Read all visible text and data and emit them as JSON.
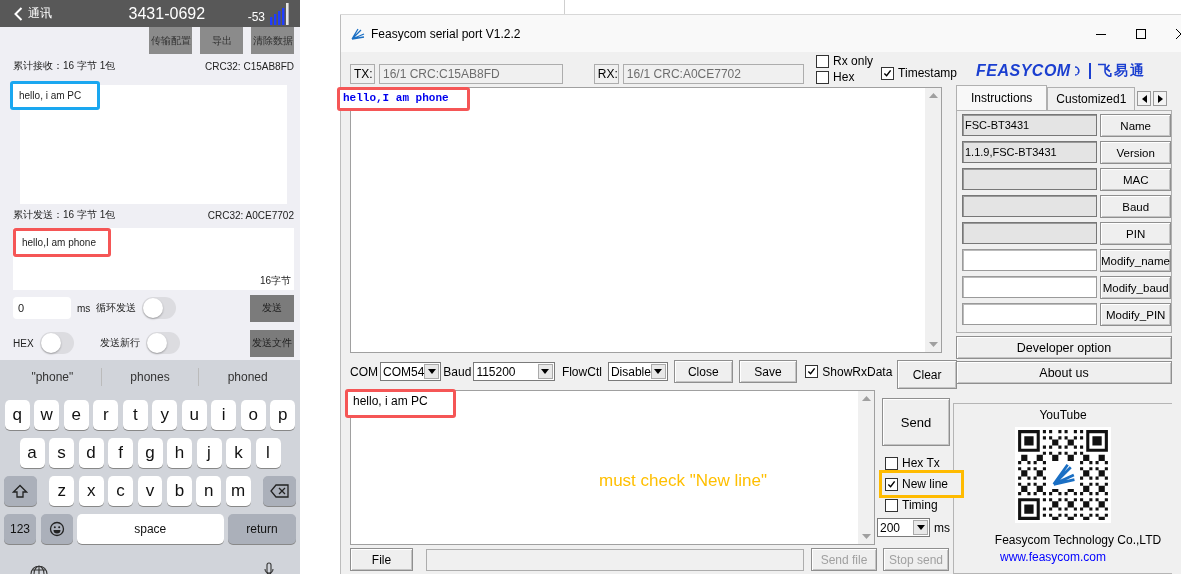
{
  "phone": {
    "back_label": "通讯",
    "title": "3431-0692",
    "rssi": "-53",
    "actions": [
      "传输配置",
      "导出",
      "清除数据"
    ],
    "received": {
      "stats": "累计接收：16 字节  1包",
      "crc": "CRC32:  C15AB8FD",
      "text": "hello, i am PC",
      "color": "#1aa7f0"
    },
    "sent": {
      "stats": "累计发送：16 字节  1包",
      "crc": "CRC32:  A0CE7702",
      "text": "hello,I am phone",
      "color": "#f55656",
      "count": "16字节"
    },
    "interval": {
      "value": "0",
      "unit": "ms"
    },
    "loop_send": {
      "label": "循环发送",
      "on": false
    },
    "hex": {
      "label": "HEX",
      "on": false
    },
    "send_newline": {
      "label": "发送新行",
      "on": false
    },
    "send_button": "发送",
    "send_file_button": "发送文件",
    "keyboard": {
      "suggestions": [
        "\"phone\"",
        "phones",
        "phoned"
      ],
      "top_row": [
        {
          "kind": "letter",
          "label": "q"
        },
        {
          "kind": "letter",
          "label": "w"
        },
        {
          "kind": "letter",
          "label": "e"
        },
        {
          "kind": "letter",
          "label": "r"
        },
        {
          "kind": "letter",
          "label": "t"
        },
        {
          "kind": "letter",
          "label": "y"
        },
        {
          "kind": "letter",
          "label": "u"
        },
        {
          "kind": "letter",
          "label": "i"
        },
        {
          "kind": "letter",
          "label": "o"
        },
        {
          "kind": "letter",
          "label": "p"
        }
      ],
      "middle_row": [
        {
          "kind": "letter",
          "label": "a"
        },
        {
          "kind": "letter",
          "label": "s"
        },
        {
          "kind": "letter",
          "label": "d"
        },
        {
          "kind": "letter",
          "label": "f"
        },
        {
          "kind": "letter",
          "label": "g"
        },
        {
          "kind": "letter",
          "label": "h"
        },
        {
          "kind": "letter",
          "label": "j"
        },
        {
          "kind": "letter",
          "label": "k"
        },
        {
          "kind": "letter",
          "label": "l"
        }
      ],
      "bottom_row": [
        {
          "kind": "shift"
        },
        {
          "kind": "letter",
          "label": "z"
        },
        {
          "kind": "letter",
          "label": "x"
        },
        {
          "kind": "letter",
          "label": "c"
        },
        {
          "kind": "letter",
          "label": "v"
        },
        {
          "kind": "letter",
          "label": "b"
        },
        {
          "kind": "letter",
          "label": "n"
        },
        {
          "kind": "letter",
          "label": "m"
        },
        {
          "kind": "delete"
        }
      ],
      "function_row": [
        {
          "kind": "mode",
          "label": "123"
        },
        {
          "kind": "emoji"
        },
        {
          "kind": "space",
          "label": "space"
        },
        {
          "kind": "return",
          "label": "return"
        }
      ]
    }
  },
  "desktop": {
    "window": {
      "title": "Feasycom serial port V1.2.2"
    },
    "tx_label": "TX:",
    "tx_status": "16/1 CRC:C15AB8FD",
    "rx_label": "RX:",
    "rx_status": "16/1 CRC:A0CE7702",
    "options": [
      {
        "label": "Rx only",
        "checked": false
      },
      {
        "label": "Hex",
        "checked": false
      },
      {
        "label": "Timestamp",
        "checked": true
      }
    ],
    "receive_text": {
      "text": "hello,I am phone",
      "color": "#f55656"
    },
    "controls": {
      "com_label": "COM",
      "com": "COM54",
      "baud_label": "Baud",
      "baud": "115200",
      "flow_label": "FlowCtl",
      "flow": "Disable",
      "buttons": [
        "Close",
        "Save"
      ],
      "show_rx": {
        "label": "ShowRxData",
        "checked": true
      },
      "clear": "Clear"
    },
    "send_text": {
      "text": "hello, i am PC",
      "color": "#f55656"
    },
    "note": "must check \"New line\"",
    "send_button": "Send",
    "send_options": [
      {
        "label": "Hex Tx",
        "checked": false
      },
      {
        "label": "New line",
        "checked": true,
        "color": "#ffbb00"
      },
      {
        "label": "Timing",
        "checked": false
      }
    ],
    "period": {
      "value": "200",
      "unit": "ms"
    },
    "file_button": "File",
    "send_file": {
      "label": "Send file",
      "disabled": true
    },
    "stop_send": {
      "label": "Stop send",
      "disabled": true
    },
    "brand": {
      "logo": "FEASYCOM",
      "chinese": "飞易通"
    },
    "tabs": [
      {
        "label": "Instructions",
        "selected": true
      },
      {
        "label": "Customized1",
        "selected": false
      }
    ],
    "commands": [
      {
        "value": "FSC-BT3431",
        "button": "Name",
        "editable": false
      },
      {
        "value": "1.1.9,FSC-BT3431",
        "button": "Version",
        "editable": false
      },
      {
        "button": "MAC",
        "editable": false
      },
      {
        "button": "Baud",
        "editable": false
      },
      {
        "button": "PIN",
        "editable": false
      },
      {
        "button": "Modify_name",
        "editable": true
      },
      {
        "button": "Modify_baud",
        "editable": true
      },
      {
        "button": "Modify_PIN",
        "editable": true
      }
    ],
    "developer_button": "Developer option",
    "about_button": "About us",
    "contact": {
      "title": "YouTube",
      "company": "Feasycom Technology Co.,LTD",
      "website": "www.feasycom.com"
    }
  }
}
